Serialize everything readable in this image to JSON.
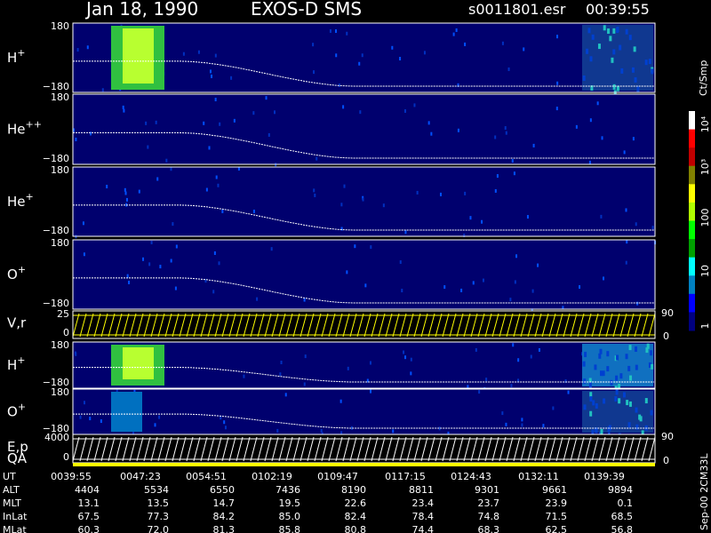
{
  "header": {
    "date": "Jan 18, 1990",
    "instrument": "EXOS-D SMS",
    "file": "s0011801.esr",
    "time": "00:39:55"
  },
  "chart_data": {
    "type": "heatmap",
    "x_range_ut": [
      "00:39:55",
      "01:39:39"
    ],
    "panels": [
      {
        "label": "H+",
        "ion": "H",
        "charge": "+",
        "ylim": [
          -180,
          180
        ],
        "ticks": [
          "180",
          "−180"
        ]
      },
      {
        "label": "He++",
        "ion": "He",
        "charge": "++",
        "ylim": [
          -180,
          180
        ],
        "ticks": [
          "180",
          "−180"
        ]
      },
      {
        "label": "He+",
        "ion": "He",
        "charge": "+",
        "ylim": [
          -180,
          180
        ],
        "ticks": [
          "180",
          "−180"
        ]
      },
      {
        "label": "O+",
        "ion": "O",
        "charge": "+",
        "ylim": [
          -180,
          180
        ],
        "ticks": [
          "180",
          "−180"
        ]
      },
      {
        "label": "V,r",
        "ion": "V,r",
        "charge": "",
        "ylim": [
          0,
          25
        ],
        "ticks": [
          "25",
          "0"
        ],
        "right_ticks": [
          "90",
          "0"
        ]
      },
      {
        "label": "H+",
        "ion": "H",
        "charge": "+",
        "ylim": [
          -180,
          180
        ],
        "ticks": [
          "180",
          "−180"
        ]
      },
      {
        "label": "O+",
        "ion": "O",
        "charge": "+",
        "ylim": [
          -180,
          180
        ],
        "ticks": [
          "180",
          "−180"
        ]
      },
      {
        "label": "E,p",
        "ion": "E,p",
        "charge": "",
        "ylim": [
          0,
          4000
        ],
        "ticks": [
          "4000",
          "0"
        ],
        "right_ticks": [
          "90",
          "0"
        ]
      }
    ],
    "qa_label": "QA",
    "colorbar": {
      "unit": "Ct/Smp",
      "scale": "log",
      "range": [
        1,
        10000
      ],
      "tick_labels": [
        "10⁴",
        "10³",
        "100",
        "10",
        "1"
      ],
      "colors": [
        "#ffffff",
        "#ff0000",
        "#c00000",
        "#808000",
        "#ffff00",
        "#b0ff00",
        "#00ff00",
        "#00a000",
        "#00ffff",
        "#0080c0",
        "#0000ff",
        "#000080"
      ]
    },
    "ephemeris": {
      "row_labels": [
        "UT",
        "ALT",
        "MLT",
        "InLat",
        "MLat"
      ],
      "columns": [
        [
          "0039:55",
          "4404",
          "13.1",
          "67.5",
          "60.3"
        ],
        [
          "0047:23",
          "5534",
          "13.5",
          "77.3",
          "72.0"
        ],
        [
          "0054:51",
          "6550",
          "14.7",
          "84.2",
          "81.3"
        ],
        [
          "0102:19",
          "7436",
          "19.5",
          "85.0",
          "85.8"
        ],
        [
          "0109:47",
          "8190",
          "22.6",
          "82.4",
          "80.8"
        ],
        [
          "0117:15",
          "8811",
          "23.4",
          "78.4",
          "74.4"
        ],
        [
          "0124:43",
          "9301",
          "23.7",
          "74.8",
          "68.3"
        ],
        [
          "0132:11",
          "9661",
          "23.9",
          "71.5",
          "62.5"
        ],
        [
          "0139:39",
          "9894",
          "0.1",
          "68.5",
          "56.8"
        ]
      ]
    },
    "footer_vertical": "Sep-00  2CM33L"
  }
}
